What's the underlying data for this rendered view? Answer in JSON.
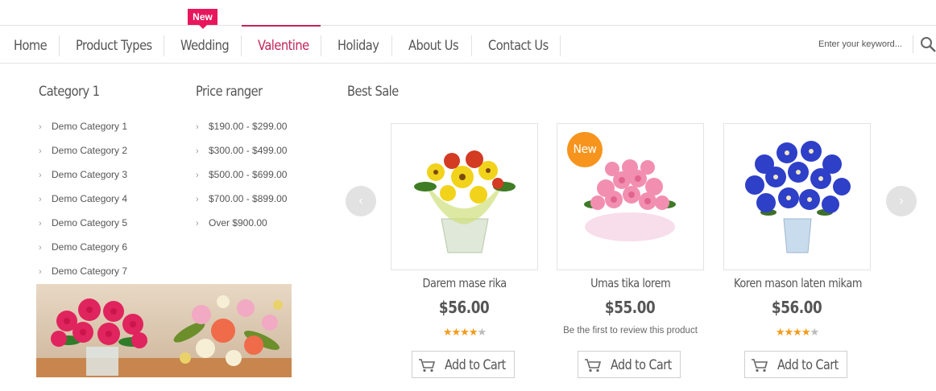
{
  "nav": {
    "items": [
      {
        "label": "Home"
      },
      {
        "label": "Product Types"
      },
      {
        "label": "Wedding",
        "badge": "New"
      },
      {
        "label": "Valentine",
        "active": true
      },
      {
        "label": "Holiday"
      },
      {
        "label": "About Us"
      },
      {
        "label": "Contact Us"
      }
    ],
    "search": {
      "placeholder": "Enter your keyword..."
    },
    "accent_color": "#c4245b"
  },
  "menu": {
    "categories": {
      "title": "Category 1",
      "items": [
        "Demo Category 1",
        "Demo Category 2",
        "Demo Category 3",
        "Demo Category 4",
        "Demo Category 5",
        "Demo Category 6",
        "Demo Category 7"
      ]
    },
    "prices": {
      "title": "Price ranger",
      "items": [
        "$190.00 - $299.00",
        "$300.00 - $499.00",
        "$500.00 - $699.00",
        "$700.00 - $899.00",
        "Over $900.00"
      ]
    },
    "best_sale": {
      "title": "Best Sale",
      "products": [
        {
          "name": "Darem mase rika",
          "price": "$56.00",
          "rating": 4,
          "max_rating": 5,
          "button": "Add to Cart"
        },
        {
          "name": "Umas tika lorem",
          "price": "$55.00",
          "badge": "New",
          "review_text": "Be the first to review this product",
          "button": "Add to Cart"
        },
        {
          "name": "Koren mason laten mikam",
          "price": "$56.00",
          "rating": 4,
          "max_rating": 5,
          "button": "Add to Cart"
        }
      ]
    }
  }
}
